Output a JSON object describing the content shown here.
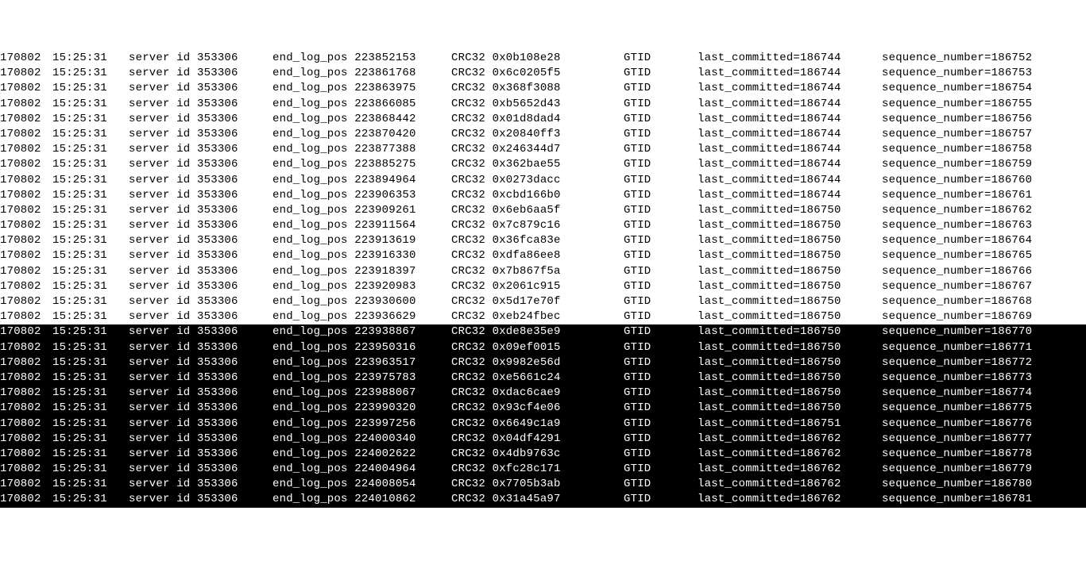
{
  "labels": {
    "server_id_prefix": "server id",
    "end_log_pos_prefix": "end_log_pos",
    "crc32_prefix": "CRC32",
    "last_committed_prefix": "last_committed=",
    "sequence_number_prefix": "sequence_number="
  },
  "rows": [
    {
      "date": "170802",
      "time": "15:25:31",
      "server_id": "353306",
      "end_log_pos": "223852153",
      "crc32": "0x0b108e28",
      "gtid": "GTID",
      "last_committed": "186744",
      "sequence_number": "186752",
      "selected": false
    },
    {
      "date": "170802",
      "time": "15:25:31",
      "server_id": "353306",
      "end_log_pos": "223861768",
      "crc32": "0x6c0205f5",
      "gtid": "GTID",
      "last_committed": "186744",
      "sequence_number": "186753",
      "selected": false
    },
    {
      "date": "170802",
      "time": "15:25:31",
      "server_id": "353306",
      "end_log_pos": "223863975",
      "crc32": "0x368f3088",
      "gtid": "GTID",
      "last_committed": "186744",
      "sequence_number": "186754",
      "selected": false
    },
    {
      "date": "170802",
      "time": "15:25:31",
      "server_id": "353306",
      "end_log_pos": "223866085",
      "crc32": "0xb5652d43",
      "gtid": "GTID",
      "last_committed": "186744",
      "sequence_number": "186755",
      "selected": false
    },
    {
      "date": "170802",
      "time": "15:25:31",
      "server_id": "353306",
      "end_log_pos": "223868442",
      "crc32": "0x01d8dad4",
      "gtid": "GTID",
      "last_committed": "186744",
      "sequence_number": "186756",
      "selected": false
    },
    {
      "date": "170802",
      "time": "15:25:31",
      "server_id": "353306",
      "end_log_pos": "223870420",
      "crc32": "0x20840ff3",
      "gtid": "GTID",
      "last_committed": "186744",
      "sequence_number": "186757",
      "selected": false
    },
    {
      "date": "170802",
      "time": "15:25:31",
      "server_id": "353306",
      "end_log_pos": "223877388",
      "crc32": "0x246344d7",
      "gtid": "GTID",
      "last_committed": "186744",
      "sequence_number": "186758",
      "selected": false
    },
    {
      "date": "170802",
      "time": "15:25:31",
      "server_id": "353306",
      "end_log_pos": "223885275",
      "crc32": "0x362bae55",
      "gtid": "GTID",
      "last_committed": "186744",
      "sequence_number": "186759",
      "selected": false
    },
    {
      "date": "170802",
      "time": "15:25:31",
      "server_id": "353306",
      "end_log_pos": "223894964",
      "crc32": "0x0273dacc",
      "gtid": "GTID",
      "last_committed": "186744",
      "sequence_number": "186760",
      "selected": false
    },
    {
      "date": "170802",
      "time": "15:25:31",
      "server_id": "353306",
      "end_log_pos": "223906353",
      "crc32": "0xcbd166b0",
      "gtid": "GTID",
      "last_committed": "186744",
      "sequence_number": "186761",
      "selected": false
    },
    {
      "date": "170802",
      "time": "15:25:31",
      "server_id": "353306",
      "end_log_pos": "223909261",
      "crc32": "0x6eb6aa5f",
      "gtid": "GTID",
      "last_committed": "186750",
      "sequence_number": "186762",
      "selected": false
    },
    {
      "date": "170802",
      "time": "15:25:31",
      "server_id": "353306",
      "end_log_pos": "223911564",
      "crc32": "0x7c879c16",
      "gtid": "GTID",
      "last_committed": "186750",
      "sequence_number": "186763",
      "selected": false
    },
    {
      "date": "170802",
      "time": "15:25:31",
      "server_id": "353306",
      "end_log_pos": "223913619",
      "crc32": "0x36fca83e",
      "gtid": "GTID",
      "last_committed": "186750",
      "sequence_number": "186764",
      "selected": false
    },
    {
      "date": "170802",
      "time": "15:25:31",
      "server_id": "353306",
      "end_log_pos": "223916330",
      "crc32": "0xdfa86ee8",
      "gtid": "GTID",
      "last_committed": "186750",
      "sequence_number": "186765",
      "selected": false
    },
    {
      "date": "170802",
      "time": "15:25:31",
      "server_id": "353306",
      "end_log_pos": "223918397",
      "crc32": "0x7b867f5a",
      "gtid": "GTID",
      "last_committed": "186750",
      "sequence_number": "186766",
      "selected": false
    },
    {
      "date": "170802",
      "time": "15:25:31",
      "server_id": "353306",
      "end_log_pos": "223920983",
      "crc32": "0x2061c915",
      "gtid": "GTID",
      "last_committed": "186750",
      "sequence_number": "186767",
      "selected": false
    },
    {
      "date": "170802",
      "time": "15:25:31",
      "server_id": "353306",
      "end_log_pos": "223930600",
      "crc32": "0x5d17e70f",
      "gtid": "GTID",
      "last_committed": "186750",
      "sequence_number": "186768",
      "selected": false
    },
    {
      "date": "170802",
      "time": "15:25:31",
      "server_id": "353306",
      "end_log_pos": "223936629",
      "crc32": "0xeb24fbec",
      "gtid": "GTID",
      "last_committed": "186750",
      "sequence_number": "186769",
      "selected": false
    },
    {
      "date": "170802",
      "time": "15:25:31",
      "server_id": "353306",
      "end_log_pos": "223938867",
      "crc32": "0xde8e35e9",
      "gtid": "GTID",
      "last_committed": "186750",
      "sequence_number": "186770",
      "selected": true
    },
    {
      "date": "170802",
      "time": "15:25:31",
      "server_id": "353306",
      "end_log_pos": "223950316",
      "crc32": "0x09ef0015",
      "gtid": "GTID",
      "last_committed": "186750",
      "sequence_number": "186771",
      "selected": true
    },
    {
      "date": "170802",
      "time": "15:25:31",
      "server_id": "353306",
      "end_log_pos": "223963517",
      "crc32": "0x9982e56d",
      "gtid": "GTID",
      "last_committed": "186750",
      "sequence_number": "186772",
      "selected": true
    },
    {
      "date": "170802",
      "time": "15:25:31",
      "server_id": "353306",
      "end_log_pos": "223975783",
      "crc32": "0xe5661c24",
      "gtid": "GTID",
      "last_committed": "186750",
      "sequence_number": "186773",
      "selected": true
    },
    {
      "date": "170802",
      "time": "15:25:31",
      "server_id": "353306",
      "end_log_pos": "223988067",
      "crc32": "0xdac6cae9",
      "gtid": "GTID",
      "last_committed": "186750",
      "sequence_number": "186774",
      "selected": true
    },
    {
      "date": "170802",
      "time": "15:25:31",
      "server_id": "353306",
      "end_log_pos": "223990320",
      "crc32": "0x93cf4e06",
      "gtid": "GTID",
      "last_committed": "186750",
      "sequence_number": "186775",
      "selected": true
    },
    {
      "date": "170802",
      "time": "15:25:31",
      "server_id": "353306",
      "end_log_pos": "223997256",
      "crc32": "0x6649c1a9",
      "gtid": "GTID",
      "last_committed": "186751",
      "sequence_number": "186776",
      "selected": true
    },
    {
      "date": "170802",
      "time": "15:25:31",
      "server_id": "353306",
      "end_log_pos": "224000340",
      "crc32": "0x04df4291",
      "gtid": "GTID",
      "last_committed": "186762",
      "sequence_number": "186777",
      "selected": true
    },
    {
      "date": "170802",
      "time": "15:25:31",
      "server_id": "353306",
      "end_log_pos": "224002622",
      "crc32": "0x4db9763c",
      "gtid": "GTID",
      "last_committed": "186762",
      "sequence_number": "186778",
      "selected": true
    },
    {
      "date": "170802",
      "time": "15:25:31",
      "server_id": "353306",
      "end_log_pos": "224004964",
      "crc32": "0xfc28c171",
      "gtid": "GTID",
      "last_committed": "186762",
      "sequence_number": "186779",
      "selected": true
    },
    {
      "date": "170802",
      "time": "15:25:31",
      "server_id": "353306",
      "end_log_pos": "224008054",
      "crc32": "0x7705b3ab",
      "gtid": "GTID",
      "last_committed": "186762",
      "sequence_number": "186780",
      "selected": true
    },
    {
      "date": "170802",
      "time": "15:25:31",
      "server_id": "353306",
      "end_log_pos": "224010862",
      "crc32": "0x31a45a97",
      "gtid": "GTID",
      "last_committed": "186762",
      "sequence_number": "186781",
      "selected": true
    }
  ]
}
